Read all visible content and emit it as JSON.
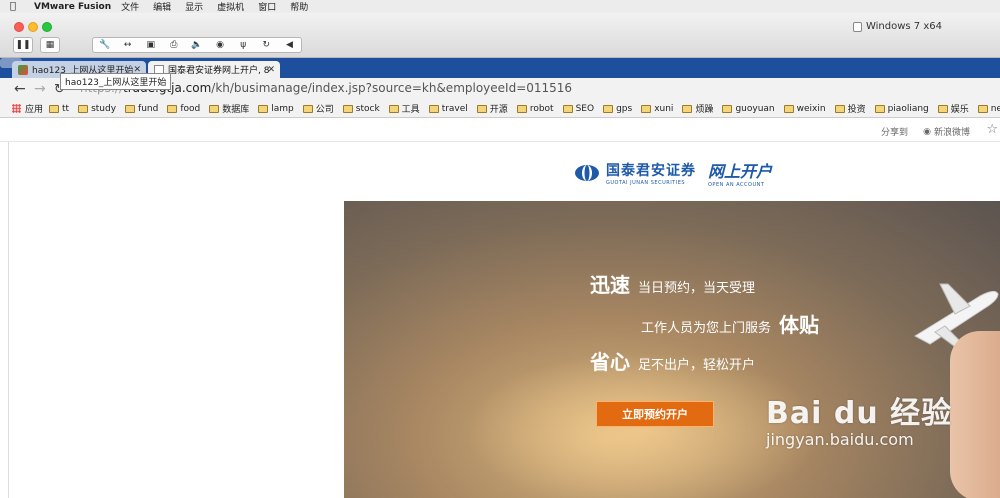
{
  "menubar": {
    "app_name": "VMware Fusion",
    "items": [
      "文件",
      "编辑",
      "显示",
      "虚拟机",
      "窗口",
      "帮助"
    ]
  },
  "vm": {
    "title": "Windows 7 x64"
  },
  "tabs": [
    {
      "title": "hao123_上网从这里开始",
      "active": false
    },
    {
      "title": "国泰君安证券网上开户, 8",
      "active": true
    }
  ],
  "tooltip": "hao123_上网从这里开始",
  "address": {
    "scheme": "https://",
    "host": "trade.gtja.com",
    "path": "/kh/busimanage/index.jsp?source=kh&employeeId=011516"
  },
  "bookmarks": {
    "apps_label": "应用",
    "items": [
      "tt",
      "study",
      "fund",
      "food",
      "数据库",
      "lamp",
      "公司",
      "stock",
      "工具",
      "travel",
      "开源",
      "robot",
      "SEO",
      "gps",
      "xuni",
      "烦躁",
      "guoyuan",
      "weixin",
      "投资",
      "piaoliang",
      "娱乐",
      "new"
    ]
  },
  "sharebar": {
    "share_label": "分享到",
    "weibo_label": "新浪微博"
  },
  "logo": {
    "brand_cn": "国泰君安证券",
    "brand_en": "GUOTAI JUNAN SECURITIES",
    "open_cn": "网上开户",
    "open_en": "OPEN AN ACCOUNT"
  },
  "hero": {
    "line1_big": "迅速",
    "line1_small": "当日预约，当天受理",
    "line2_small": "工作人员为您上门服务",
    "line2_big": "体贴",
    "line3_big": "省心",
    "line3_small": "足不出户，轻松开户",
    "cta_label": "立即预约开户"
  },
  "watermark": {
    "logo": "Bai du 经验",
    "url": "jingyan.baidu.com"
  },
  "colors": {
    "tabstrip": "#1d4f9e",
    "brand_blue": "#1e5aa8",
    "cta_orange": "#e26a10"
  }
}
